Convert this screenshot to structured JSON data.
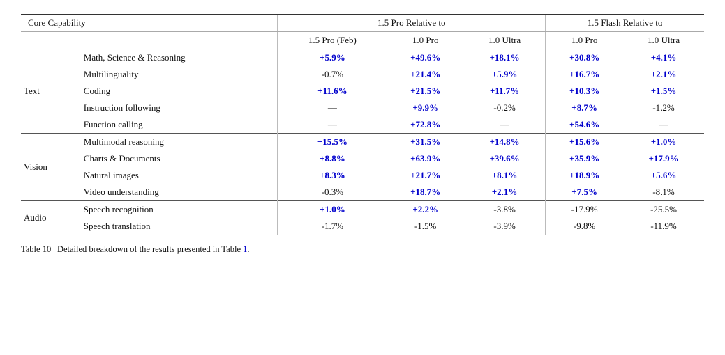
{
  "header": {
    "col_group_label": "Core Capability",
    "pro_relative_header": "1.5 Pro Relative to",
    "flash_relative_header": "1.5 Flash Relative to",
    "sub_headers": [
      "1.5 Pro (Feb)",
      "1.0 Pro",
      "1.0 Ultra",
      "1.0 Pro",
      "1.0 Ultra"
    ]
  },
  "sections": [
    {
      "group": "Text",
      "rows": [
        {
          "capability": "Math, Science & Reasoning",
          "pro_feb": "+5.9%",
          "pro_feb_blue": true,
          "pro_1": "+49.6%",
          "pro_1_blue": true,
          "ultra_1": "+18.1%",
          "ultra_1_blue": true,
          "flash_pro": "+30.8%",
          "flash_pro_blue": true,
          "flash_ultra": "+4.1%",
          "flash_ultra_blue": true
        },
        {
          "capability": "Multilinguality",
          "pro_feb": "-0.7%",
          "pro_feb_blue": false,
          "pro_1": "+21.4%",
          "pro_1_blue": true,
          "ultra_1": "+5.9%",
          "ultra_1_blue": true,
          "flash_pro": "+16.7%",
          "flash_pro_blue": true,
          "flash_ultra": "+2.1%",
          "flash_ultra_blue": true
        },
        {
          "capability": "Coding",
          "pro_feb": "+11.6%",
          "pro_feb_blue": true,
          "pro_1": "+21.5%",
          "pro_1_blue": true,
          "ultra_1": "+11.7%",
          "ultra_1_blue": true,
          "flash_pro": "+10.3%",
          "flash_pro_blue": true,
          "flash_ultra": "+1.5%",
          "flash_ultra_blue": true
        },
        {
          "capability": "Instruction following",
          "pro_feb": "—",
          "pro_feb_blue": false,
          "pro_1": "+9.9%",
          "pro_1_blue": true,
          "ultra_1": "-0.2%",
          "ultra_1_blue": false,
          "flash_pro": "+8.7%",
          "flash_pro_blue": true,
          "flash_ultra": "-1.2%",
          "flash_ultra_blue": false
        },
        {
          "capability": "Function calling",
          "pro_feb": "—",
          "pro_feb_blue": false,
          "pro_1": "+72.8%",
          "pro_1_blue": true,
          "ultra_1": "—",
          "ultra_1_blue": false,
          "flash_pro": "+54.6%",
          "flash_pro_blue": true,
          "flash_ultra": "—",
          "flash_ultra_blue": false
        }
      ]
    },
    {
      "group": "Vision",
      "rows": [
        {
          "capability": "Multimodal reasoning",
          "pro_feb": "+15.5%",
          "pro_feb_blue": true,
          "pro_1": "+31.5%",
          "pro_1_blue": true,
          "ultra_1": "+14.8%",
          "ultra_1_blue": true,
          "flash_pro": "+15.6%",
          "flash_pro_blue": true,
          "flash_ultra": "+1.0%",
          "flash_ultra_blue": true
        },
        {
          "capability": "Charts & Documents",
          "pro_feb": "+8.8%",
          "pro_feb_blue": true,
          "pro_1": "+63.9%",
          "pro_1_blue": true,
          "ultra_1": "+39.6%",
          "ultra_1_blue": true,
          "flash_pro": "+35.9%",
          "flash_pro_blue": true,
          "flash_ultra": "+17.9%",
          "flash_ultra_blue": true
        },
        {
          "capability": "Natural images",
          "pro_feb": "+8.3%",
          "pro_feb_blue": true,
          "pro_1": "+21.7%",
          "pro_1_blue": true,
          "ultra_1": "+8.1%",
          "ultra_1_blue": true,
          "flash_pro": "+18.9%",
          "flash_pro_blue": true,
          "flash_ultra": "+5.6%",
          "flash_ultra_blue": true
        },
        {
          "capability": "Video understanding",
          "pro_feb": "-0.3%",
          "pro_feb_blue": false,
          "pro_1": "+18.7%",
          "pro_1_blue": true,
          "ultra_1": "+2.1%",
          "ultra_1_blue": true,
          "flash_pro": "+7.5%",
          "flash_pro_blue": true,
          "flash_ultra": "-8.1%",
          "flash_ultra_blue": false
        }
      ]
    },
    {
      "group": "Audio",
      "rows": [
        {
          "capability": "Speech recognition",
          "pro_feb": "+1.0%",
          "pro_feb_blue": true,
          "pro_1": "+2.2%",
          "pro_1_blue": true,
          "ultra_1": "-3.8%",
          "ultra_1_blue": false,
          "flash_pro": "-17.9%",
          "flash_pro_blue": false,
          "flash_ultra": "-25.5%",
          "flash_ultra_blue": false
        },
        {
          "capability": "Speech translation",
          "pro_feb": "-1.7%",
          "pro_feb_blue": false,
          "pro_1": "-1.5%",
          "pro_1_blue": false,
          "ultra_1": "-3.9%",
          "ultra_1_blue": false,
          "flash_pro": "-9.8%",
          "flash_pro_blue": false,
          "flash_ultra": "-11.9%",
          "flash_ultra_blue": false
        }
      ]
    }
  ],
  "caption": "Table 10 | Detailed breakdown of the results presented in Table 1."
}
